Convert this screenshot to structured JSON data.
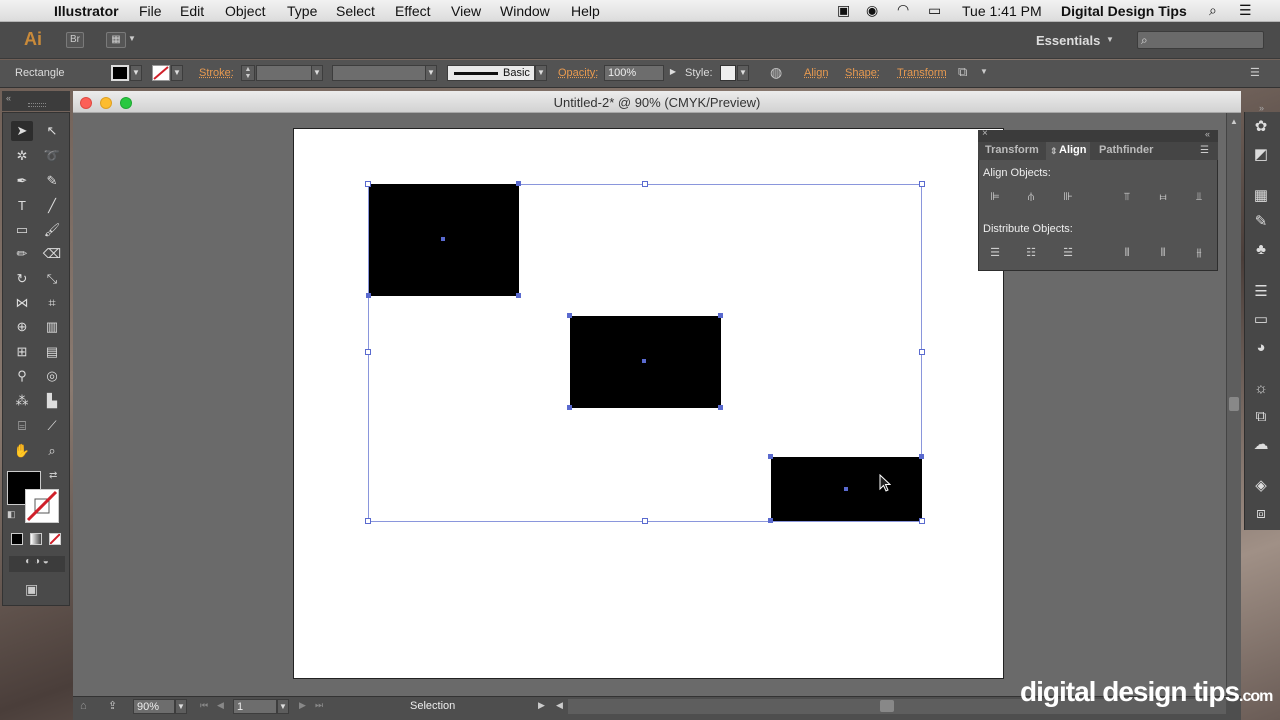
{
  "menubar": {
    "apple_icon": "apple-icon",
    "app_name": "Illustrator",
    "items": [
      "File",
      "Edit",
      "Object",
      "Type",
      "Select",
      "Effect",
      "View",
      "Window",
      "Help"
    ],
    "clock": "Tue 1:41 PM",
    "user": "Digital Design Tips"
  },
  "appbar": {
    "logo": "Ai",
    "bridge": "Br",
    "workspace": "Essentials"
  },
  "control": {
    "tool_name": "Rectangle",
    "stroke_label": "Stroke:",
    "brush_label": "Basic",
    "opacity_label": "Opacity:",
    "opacity_value": "100%",
    "style_label": "Style:",
    "align_label": "Align",
    "shape_label": "Shape:",
    "transform_label": "Transform"
  },
  "document": {
    "title": "Untitled-2* @ 90% (CMYK/Preview)"
  },
  "align_panel": {
    "tabs": [
      "Transform",
      "Align",
      "Pathfinder"
    ],
    "active_tab": "Align",
    "align_objects_label": "Align Objects:",
    "distribute_objects_label": "Distribute Objects:"
  },
  "status": {
    "zoom": "90%",
    "artboard_number": "1",
    "tool": "Selection"
  },
  "watermark": {
    "brand": "digital design tips",
    "domain": ".com"
  },
  "colors": {
    "accent_orange": "#e89a50",
    "selection_blue": "#5a6acf",
    "fill": "#000000",
    "stroke_none": "#d0202a"
  }
}
